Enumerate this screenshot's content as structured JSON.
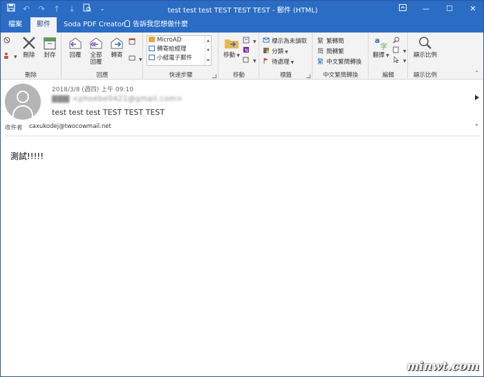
{
  "window": {
    "title": "test test test TEST TEST TEST  -  郵件 (HTML)"
  },
  "tabs": [
    {
      "label": "檔案"
    },
    {
      "label": "郵件"
    },
    {
      "label": "Soda PDF Creator"
    },
    {
      "label": "告訴我您想做什麼"
    }
  ],
  "ribbon": {
    "delete_group": {
      "label": "刪除",
      "delete_label": "刪除",
      "archive_label": "封存"
    },
    "respond_group": {
      "label": "回應",
      "reply_label": "回覆",
      "reply_all_line1": "全部",
      "reply_all_line2": "回覆",
      "forward_label": "轉寄"
    },
    "quick_steps": {
      "label": "快速步驟",
      "items": [
        "MicroAD",
        "轉寄給經理",
        "小組電子郵件"
      ]
    },
    "move_group": {
      "label": "移動",
      "move_label": "移動"
    },
    "tags_group": {
      "label": "標籤",
      "mark_unread": "標示為未讀取",
      "categorize": "分類",
      "follow_up": "待處理"
    },
    "chinese_group": {
      "label": "中文繁簡轉換",
      "to_traditional": "繁轉簡",
      "to_simplified": "簡轉繁",
      "convert": "中文繁簡轉換"
    },
    "editing_group": {
      "label": "編輯",
      "translate_label": "翻譯"
    },
    "zoom_group": {
      "label": "顯示比例",
      "zoom_label": "顯示比例"
    }
  },
  "message": {
    "date": "2018/3/8 (週四) 上午 09:10",
    "from": "▇▇▇ <phoebe0421@gmail.com>",
    "subject": "test test test TEST TEST TEST",
    "to_label": "收件者",
    "to_value": "caxukodej@twocowmail.net",
    "body": "測試!!!!!"
  },
  "watermark": "minwt.com",
  "colors": {
    "titlebar": "#2b6cc4",
    "ribbon_bg": "#f3f3f3",
    "accent": "#2b579a"
  }
}
